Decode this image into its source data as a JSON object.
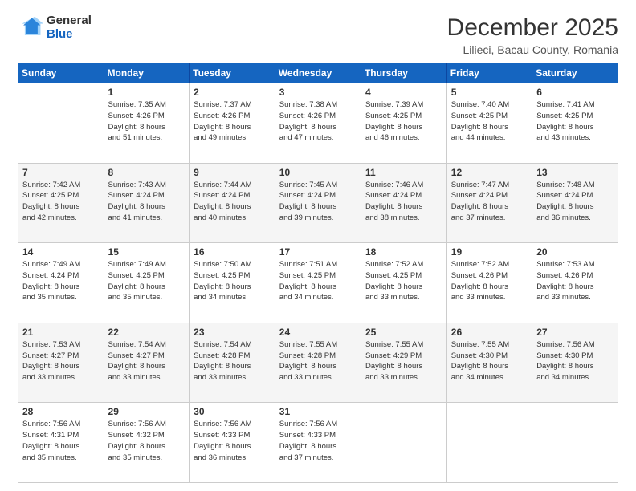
{
  "header": {
    "logo_general": "General",
    "logo_blue": "Blue",
    "title": "December 2025",
    "subtitle": "Lilieci, Bacau County, Romania"
  },
  "days_of_week": [
    "Sunday",
    "Monday",
    "Tuesday",
    "Wednesday",
    "Thursday",
    "Friday",
    "Saturday"
  ],
  "weeks": [
    [
      {
        "day": "",
        "info": ""
      },
      {
        "day": "1",
        "info": "Sunrise: 7:35 AM\nSunset: 4:26 PM\nDaylight: 8 hours\nand 51 minutes."
      },
      {
        "day": "2",
        "info": "Sunrise: 7:37 AM\nSunset: 4:26 PM\nDaylight: 8 hours\nand 49 minutes."
      },
      {
        "day": "3",
        "info": "Sunrise: 7:38 AM\nSunset: 4:26 PM\nDaylight: 8 hours\nand 47 minutes."
      },
      {
        "day": "4",
        "info": "Sunrise: 7:39 AM\nSunset: 4:25 PM\nDaylight: 8 hours\nand 46 minutes."
      },
      {
        "day": "5",
        "info": "Sunrise: 7:40 AM\nSunset: 4:25 PM\nDaylight: 8 hours\nand 44 minutes."
      },
      {
        "day": "6",
        "info": "Sunrise: 7:41 AM\nSunset: 4:25 PM\nDaylight: 8 hours\nand 43 minutes."
      }
    ],
    [
      {
        "day": "7",
        "info": "Sunrise: 7:42 AM\nSunset: 4:25 PM\nDaylight: 8 hours\nand 42 minutes."
      },
      {
        "day": "8",
        "info": "Sunrise: 7:43 AM\nSunset: 4:24 PM\nDaylight: 8 hours\nand 41 minutes."
      },
      {
        "day": "9",
        "info": "Sunrise: 7:44 AM\nSunset: 4:24 PM\nDaylight: 8 hours\nand 40 minutes."
      },
      {
        "day": "10",
        "info": "Sunrise: 7:45 AM\nSunset: 4:24 PM\nDaylight: 8 hours\nand 39 minutes."
      },
      {
        "day": "11",
        "info": "Sunrise: 7:46 AM\nSunset: 4:24 PM\nDaylight: 8 hours\nand 38 minutes."
      },
      {
        "day": "12",
        "info": "Sunrise: 7:47 AM\nSunset: 4:24 PM\nDaylight: 8 hours\nand 37 minutes."
      },
      {
        "day": "13",
        "info": "Sunrise: 7:48 AM\nSunset: 4:24 PM\nDaylight: 8 hours\nand 36 minutes."
      }
    ],
    [
      {
        "day": "14",
        "info": "Sunrise: 7:49 AM\nSunset: 4:24 PM\nDaylight: 8 hours\nand 35 minutes."
      },
      {
        "day": "15",
        "info": "Sunrise: 7:49 AM\nSunset: 4:25 PM\nDaylight: 8 hours\nand 35 minutes."
      },
      {
        "day": "16",
        "info": "Sunrise: 7:50 AM\nSunset: 4:25 PM\nDaylight: 8 hours\nand 34 minutes."
      },
      {
        "day": "17",
        "info": "Sunrise: 7:51 AM\nSunset: 4:25 PM\nDaylight: 8 hours\nand 34 minutes."
      },
      {
        "day": "18",
        "info": "Sunrise: 7:52 AM\nSunset: 4:25 PM\nDaylight: 8 hours\nand 33 minutes."
      },
      {
        "day": "19",
        "info": "Sunrise: 7:52 AM\nSunset: 4:26 PM\nDaylight: 8 hours\nand 33 minutes."
      },
      {
        "day": "20",
        "info": "Sunrise: 7:53 AM\nSunset: 4:26 PM\nDaylight: 8 hours\nand 33 minutes."
      }
    ],
    [
      {
        "day": "21",
        "info": "Sunrise: 7:53 AM\nSunset: 4:27 PM\nDaylight: 8 hours\nand 33 minutes."
      },
      {
        "day": "22",
        "info": "Sunrise: 7:54 AM\nSunset: 4:27 PM\nDaylight: 8 hours\nand 33 minutes."
      },
      {
        "day": "23",
        "info": "Sunrise: 7:54 AM\nSunset: 4:28 PM\nDaylight: 8 hours\nand 33 minutes."
      },
      {
        "day": "24",
        "info": "Sunrise: 7:55 AM\nSunset: 4:28 PM\nDaylight: 8 hours\nand 33 minutes."
      },
      {
        "day": "25",
        "info": "Sunrise: 7:55 AM\nSunset: 4:29 PM\nDaylight: 8 hours\nand 33 minutes."
      },
      {
        "day": "26",
        "info": "Sunrise: 7:55 AM\nSunset: 4:30 PM\nDaylight: 8 hours\nand 34 minutes."
      },
      {
        "day": "27",
        "info": "Sunrise: 7:56 AM\nSunset: 4:30 PM\nDaylight: 8 hours\nand 34 minutes."
      }
    ],
    [
      {
        "day": "28",
        "info": "Sunrise: 7:56 AM\nSunset: 4:31 PM\nDaylight: 8 hours\nand 35 minutes."
      },
      {
        "day": "29",
        "info": "Sunrise: 7:56 AM\nSunset: 4:32 PM\nDaylight: 8 hours\nand 35 minutes."
      },
      {
        "day": "30",
        "info": "Sunrise: 7:56 AM\nSunset: 4:33 PM\nDaylight: 8 hours\nand 36 minutes."
      },
      {
        "day": "31",
        "info": "Sunrise: 7:56 AM\nSunset: 4:33 PM\nDaylight: 8 hours\nand 37 minutes."
      },
      {
        "day": "",
        "info": ""
      },
      {
        "day": "",
        "info": ""
      },
      {
        "day": "",
        "info": ""
      }
    ]
  ]
}
